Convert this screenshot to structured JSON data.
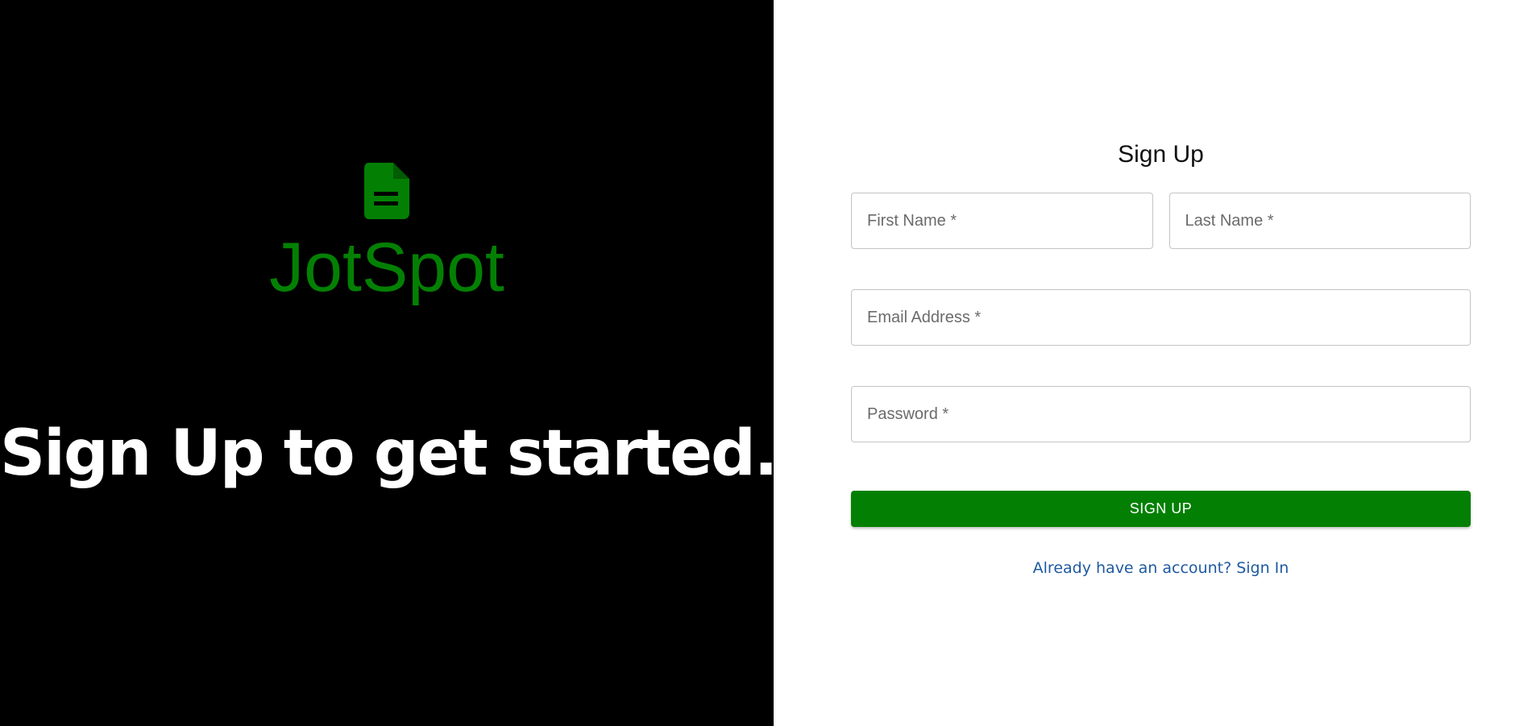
{
  "brand": {
    "name": "JotSpot",
    "icon": "document-icon",
    "color": "#038003"
  },
  "tagline": "Sign Up to get started.",
  "form": {
    "title": "Sign Up",
    "first_name_placeholder": "First Name *",
    "last_name_placeholder": "Last Name *",
    "email_placeholder": "Email Address *",
    "password_placeholder": "Password *",
    "submit_label": "SIGN UP",
    "signin_link": "Already have an account? Sign In"
  },
  "colors": {
    "left_background": "#000000",
    "accent": "#038003",
    "link": "#1f5aa0"
  }
}
